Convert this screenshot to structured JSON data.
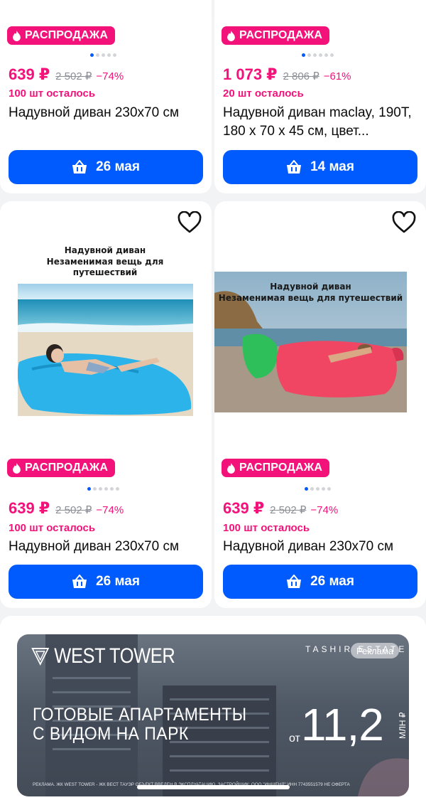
{
  "products": [
    {
      "badge": "РАСПРОДАЖА",
      "dots_total": 5,
      "dots_active": 0,
      "price": "639 ₽",
      "old_price": "2 502 ₽",
      "discount": "−74%",
      "stock": "100 шт осталось",
      "title": "Надувной диван 230х70 см",
      "delivery": "26 мая"
    },
    {
      "badge": "РАСПРОДАЖА",
      "dots_total": 6,
      "dots_active": 0,
      "price": "1 073 ₽",
      "old_price": "2 806 ₽",
      "discount": "−61%",
      "stock": "20 шт осталось",
      "title": "Надувной диван maclay, 190T, 180 х 70 х 45 см, цвет...",
      "delivery": "14 мая"
    },
    {
      "image_caption_1": "Надувной диван",
      "image_caption_2": "Незаменимая вещь для путешествий",
      "badge": "РАСПРОДАЖА",
      "dots_total": 6,
      "dots_active": 0,
      "price": "639 ₽",
      "old_price": "2 502 ₽",
      "discount": "−74%",
      "stock": "100 шт осталось",
      "title": "Надувной диван 230х70 см",
      "delivery": "26 мая"
    },
    {
      "image_caption_1": "Надувной диван",
      "image_caption_2": "Незаменимая вещь для путешествий",
      "badge": "РАСПРОДАЖА",
      "dots_total": 5,
      "dots_active": 0,
      "price": "639 ₽",
      "old_price": "2 502 ₽",
      "discount": "−74%",
      "stock": "100 шт осталось",
      "title": "Надувной диван 230х70 см",
      "delivery": "26 мая"
    }
  ],
  "ad": {
    "brand": "WEST TOWER",
    "partner": "TASHIR ESTATE",
    "label": "Реклама",
    "headline_1": "ГОТОВЫЕ АПАРТАМЕНТЫ",
    "headline_2": "С ВИДОМ НА ПАРК",
    "price_prefix": "от",
    "price": "11,2",
    "price_unit": "МЛН ₽",
    "disclaimer": "РЕКЛАМА. ЖК WEST TOWER - ЖК ВЕСТ ТАУЭР ОБЪЕКТ ВВЕДЕН В ЭКСПЛУАТАЦИЮ. ЗАСТРОЙЩИК: ООО \"ИНШЕНД\" ИНН 7743551579 НЕ ОФЕРТА"
  },
  "colors": {
    "accent": "#005bff",
    "sale": "#f2127a"
  },
  "icons": {
    "badge": "flame-icon",
    "button": "basket-icon",
    "favorite": "heart-icon"
  }
}
